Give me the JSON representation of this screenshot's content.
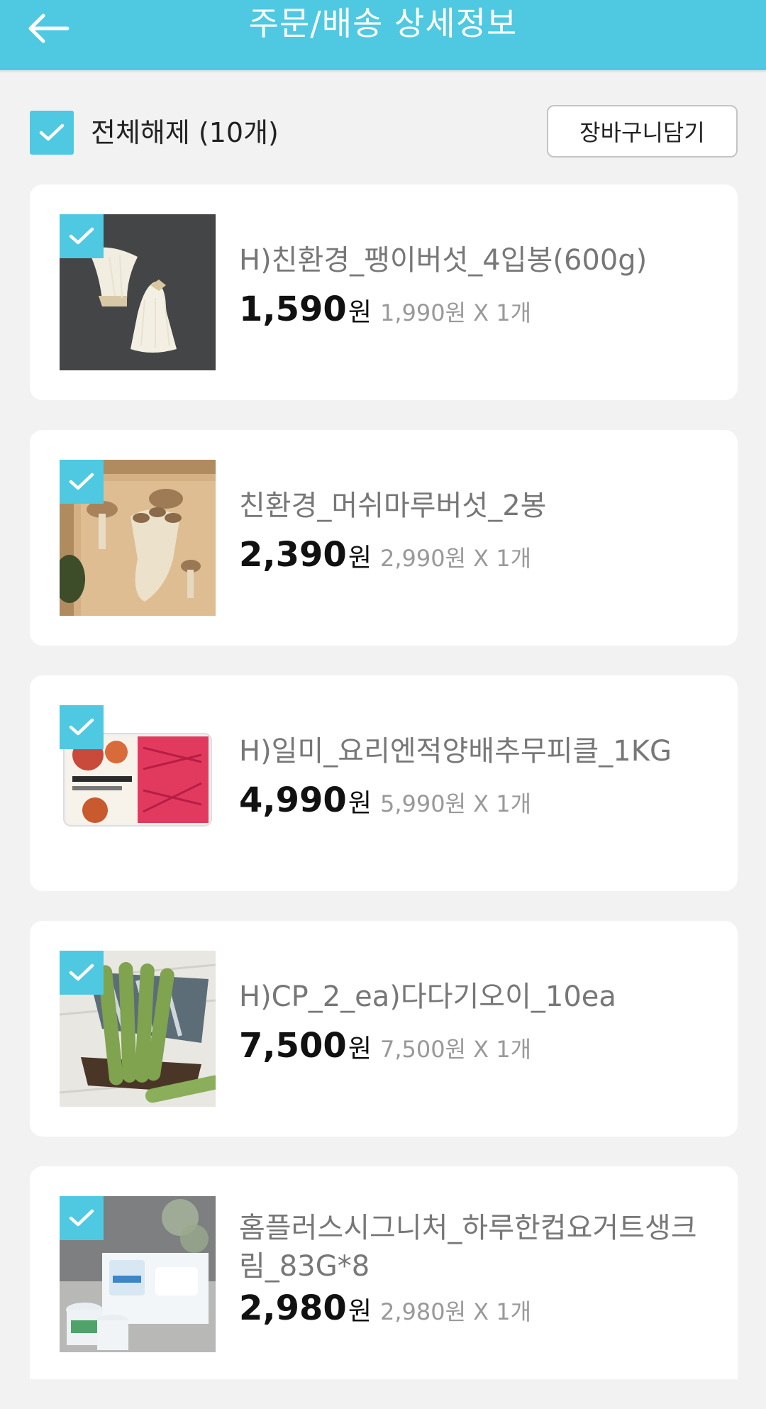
{
  "header": {
    "title": "주문/배송 상세정보"
  },
  "select_bar": {
    "label": "전체해제 (10개)",
    "cart_button": "장바구니담기",
    "all_checked": true
  },
  "items": [
    {
      "name": "H)친환경_팽이버섯_4입봉(600g)",
      "price": "1,590",
      "unit": "원",
      "original": "1,990원 X 1개",
      "checked": true,
      "image_icon": "enoki-mushroom-image"
    },
    {
      "name": "친환경_머쉬마루버섯_2봉",
      "price": "2,390",
      "unit": "원",
      "original": "2,990원 X 1개",
      "checked": true,
      "image_icon": "oyster-mushroom-image"
    },
    {
      "name": "H)일미_요리엔적양배추무피클_1KG",
      "price": "4,990",
      "unit": "원",
      "original": "5,990원 X 1개",
      "checked": true,
      "image_icon": "pickle-package-image"
    },
    {
      "name": "H)CP_2_ea)다다기오이_10ea",
      "price": "7,500",
      "unit": "원",
      "original": "7,500원 X 1개",
      "checked": true,
      "image_icon": "cucumber-basket-image"
    },
    {
      "name": "홈플러스시그니처_하루한컵요거트생크림_83G*8",
      "price": "2,980",
      "unit": "원",
      "original": "2,980원 X 1개",
      "checked": true,
      "image_icon": "yogurt-cups-image"
    }
  ],
  "colors": {
    "accent": "#4ec9e1",
    "background": "#f2f2f2",
    "card": "#ffffff",
    "price": "#111111",
    "muted": "#999999"
  }
}
